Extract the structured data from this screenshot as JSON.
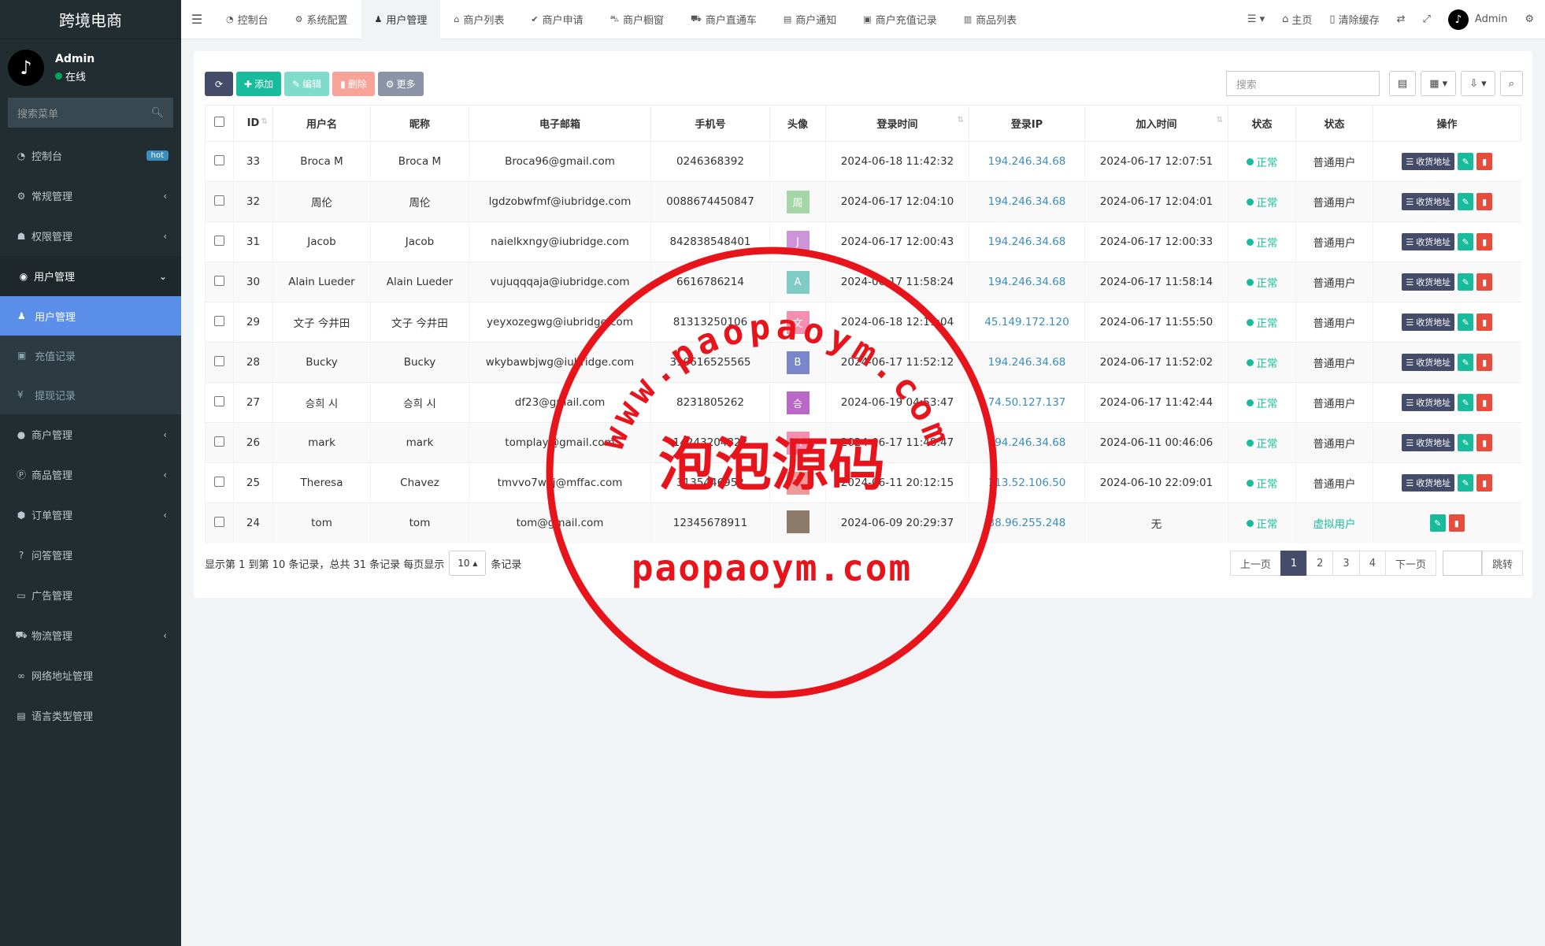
{
  "sidebar": {
    "logo": "跨境电商",
    "user_name": "Admin",
    "user_status": "在线",
    "search_placeholder": "搜索菜单",
    "menu": [
      {
        "label": "控制台",
        "icon": "dashboard-icon",
        "badge": "hot"
      },
      {
        "label": "常规管理",
        "icon": "cogs-icon"
      },
      {
        "label": "权限管理",
        "icon": "group-icon"
      },
      {
        "label": "用户管理",
        "icon": "user-circle-icon",
        "open": true,
        "children": [
          {
            "label": "用户管理",
            "icon": "user-icon",
            "active": true
          },
          {
            "label": "充值记录",
            "icon": "money-icon"
          },
          {
            "label": "提现记录",
            "icon": "yen-icon"
          }
        ]
      },
      {
        "label": "商户管理",
        "icon": "apple-icon"
      },
      {
        "label": "商品管理",
        "icon": "product-icon"
      },
      {
        "label": "订单管理",
        "icon": "cube-icon"
      },
      {
        "label": "问答管理",
        "icon": "question-icon"
      },
      {
        "label": "广告管理",
        "icon": "ad-icon"
      },
      {
        "label": "物流管理",
        "icon": "truck-icon"
      },
      {
        "label": "网络地址管理",
        "icon": "link-icon"
      },
      {
        "label": "语言类型管理",
        "icon": "language-icon"
      }
    ]
  },
  "topbar": {
    "tabs": [
      {
        "label": "控制台",
        "icon": "dashboard-icon"
      },
      {
        "label": "系统配置",
        "icon": "gear-icon"
      },
      {
        "label": "用户管理",
        "icon": "user-icon",
        "active": true
      },
      {
        "label": "商户列表",
        "icon": "home-icon"
      },
      {
        "label": "商户申请",
        "icon": "check-circle-icon"
      },
      {
        "label": "商户橱窗",
        "icon": "cart-icon"
      },
      {
        "label": "商户直通车",
        "icon": "car-icon"
      },
      {
        "label": "商户通知",
        "icon": "doc-icon"
      },
      {
        "label": "商户充值记录",
        "icon": "money-icon"
      },
      {
        "label": "商品列表",
        "icon": "shop-icon"
      }
    ],
    "home": "主页",
    "clear_cache": "清除缓存",
    "admin": "Admin"
  },
  "toolbar": {
    "add": "添加",
    "edit": "编辑",
    "delete": "删除",
    "more": "更多",
    "search_placeholder": "搜索"
  },
  "table": {
    "headers": [
      "ID",
      "用户名",
      "昵称",
      "电子邮箱",
      "手机号",
      "头像",
      "登录时间",
      "登录IP",
      "加入时间",
      "状态",
      "状态",
      "操作"
    ],
    "address_btn": "收货地址",
    "rows": [
      {
        "id": "33",
        "username": "Broca M",
        "nickname": "Broca M",
        "email": "Broca96@gmail.com",
        "phone": "0246368392",
        "avatar": "",
        "avatar_color": "",
        "login_time": "2024-06-18 11:42:32",
        "ip": "194.246.34.68",
        "join_time": "2024-06-17 12:07:51",
        "status": "正常",
        "type": "普通用户",
        "virtual": false
      },
      {
        "id": "32",
        "username": "周伦",
        "nickname": "周伦",
        "email": "lgdzobwfmf@iubridge.com",
        "phone": "0088674450847",
        "avatar": "周",
        "avatar_color": "#a5d6a7",
        "login_time": "2024-06-17 12:04:10",
        "ip": "194.246.34.68",
        "join_time": "2024-06-17 12:04:01",
        "status": "正常",
        "type": "普通用户",
        "virtual": false
      },
      {
        "id": "31",
        "username": "Jacob",
        "nickname": "Jacob",
        "email": "naielkxngy@iubridge.com",
        "phone": "842838548401",
        "avatar": "J",
        "avatar_color": "#ce93d8",
        "login_time": "2024-06-17 12:00:43",
        "ip": "194.246.34.68",
        "join_time": "2024-06-17 12:00:33",
        "status": "正常",
        "type": "普通用户",
        "virtual": false
      },
      {
        "id": "30",
        "username": "Alain Lueder",
        "nickname": "Alain Lueder",
        "email": "vujuqqqaja@iubridge.com",
        "phone": "6616786214",
        "avatar": "A",
        "avatar_color": "#80cbc4",
        "login_time": "2024-06-17 11:58:24",
        "ip": "194.246.34.68",
        "join_time": "2024-06-17 11:58:14",
        "status": "正常",
        "type": "普通用户",
        "virtual": false
      },
      {
        "id": "29",
        "username": "文子 今井田",
        "nickname": "文子 今井田",
        "email": "yeyxozegwg@iubridge.com",
        "phone": "81313250106",
        "avatar": "文",
        "avatar_color": "#f48fb1",
        "login_time": "2024-06-18 12:11:04",
        "ip": "45.149.172.120",
        "join_time": "2024-06-17 11:55:50",
        "status": "正常",
        "type": "普通用户",
        "virtual": false
      },
      {
        "id": "28",
        "username": "Bucky",
        "nickname": "Bucky",
        "email": "wkybawbjwg@iubridge.com",
        "phone": "310616525565",
        "avatar": "B",
        "avatar_color": "#7986cb",
        "login_time": "2024-06-17 11:52:12",
        "ip": "194.246.34.68",
        "join_time": "2024-06-17 11:52:02",
        "status": "正常",
        "type": "普通用户",
        "virtual": false
      },
      {
        "id": "27",
        "username": "승희 시",
        "nickname": "승희 시",
        "email": "df23@gmail.com",
        "phone": "8231805262",
        "avatar": "승",
        "avatar_color": "#ba68c8",
        "login_time": "2024-06-19 04:53:47",
        "ip": "74.50.127.137",
        "join_time": "2024-06-17 11:42:44",
        "status": "正常",
        "type": "普通用户",
        "virtual": false
      },
      {
        "id": "26",
        "username": "mark",
        "nickname": "mark",
        "email": "tomplay@gmail.com",
        "phone": "14243204322",
        "avatar": "M",
        "avatar_color": "#f48fb1",
        "login_time": "2024-06-17 11:48:47",
        "ip": "194.246.34.68",
        "join_time": "2024-06-11 00:46:06",
        "status": "正常",
        "type": "普通用户",
        "virtual": false
      },
      {
        "id": "25",
        "username": "Theresa",
        "nickname": "Chavez",
        "email": "tmvvo7wvj@mffac.com",
        "phone": "3135446952",
        "avatar": "T",
        "avatar_color": "#ef9a9a",
        "login_time": "2024-06-11 20:12:15",
        "ip": "113.52.106.50",
        "join_time": "2024-06-10 22:09:01",
        "status": "正常",
        "type": "普通用户",
        "virtual": false
      },
      {
        "id": "24",
        "username": "tom",
        "nickname": "tom",
        "email": "tom@gmail.com",
        "phone": "12345678911",
        "avatar": "",
        "avatar_color": "#8d7b6a",
        "login_time": "2024-06-09 20:29:37",
        "ip": "38.96.255.248",
        "join_time": "无",
        "status": "正常",
        "type": "虚拟用户",
        "virtual": true
      }
    ]
  },
  "footer": {
    "summary": "显示第 1 到第 10 条记录，总共 31 条记录 每页显示",
    "page_size": "10",
    "suffix": "条记录",
    "prev": "上一页",
    "pages": [
      "1",
      "2",
      "3",
      "4"
    ],
    "next": "下一页",
    "go": "跳转"
  },
  "watermark": {
    "top": "www.paopaoym.com",
    "middle": "泡泡源码",
    "bottom": "paopaoym.com",
    "color": "#e8141c"
  }
}
